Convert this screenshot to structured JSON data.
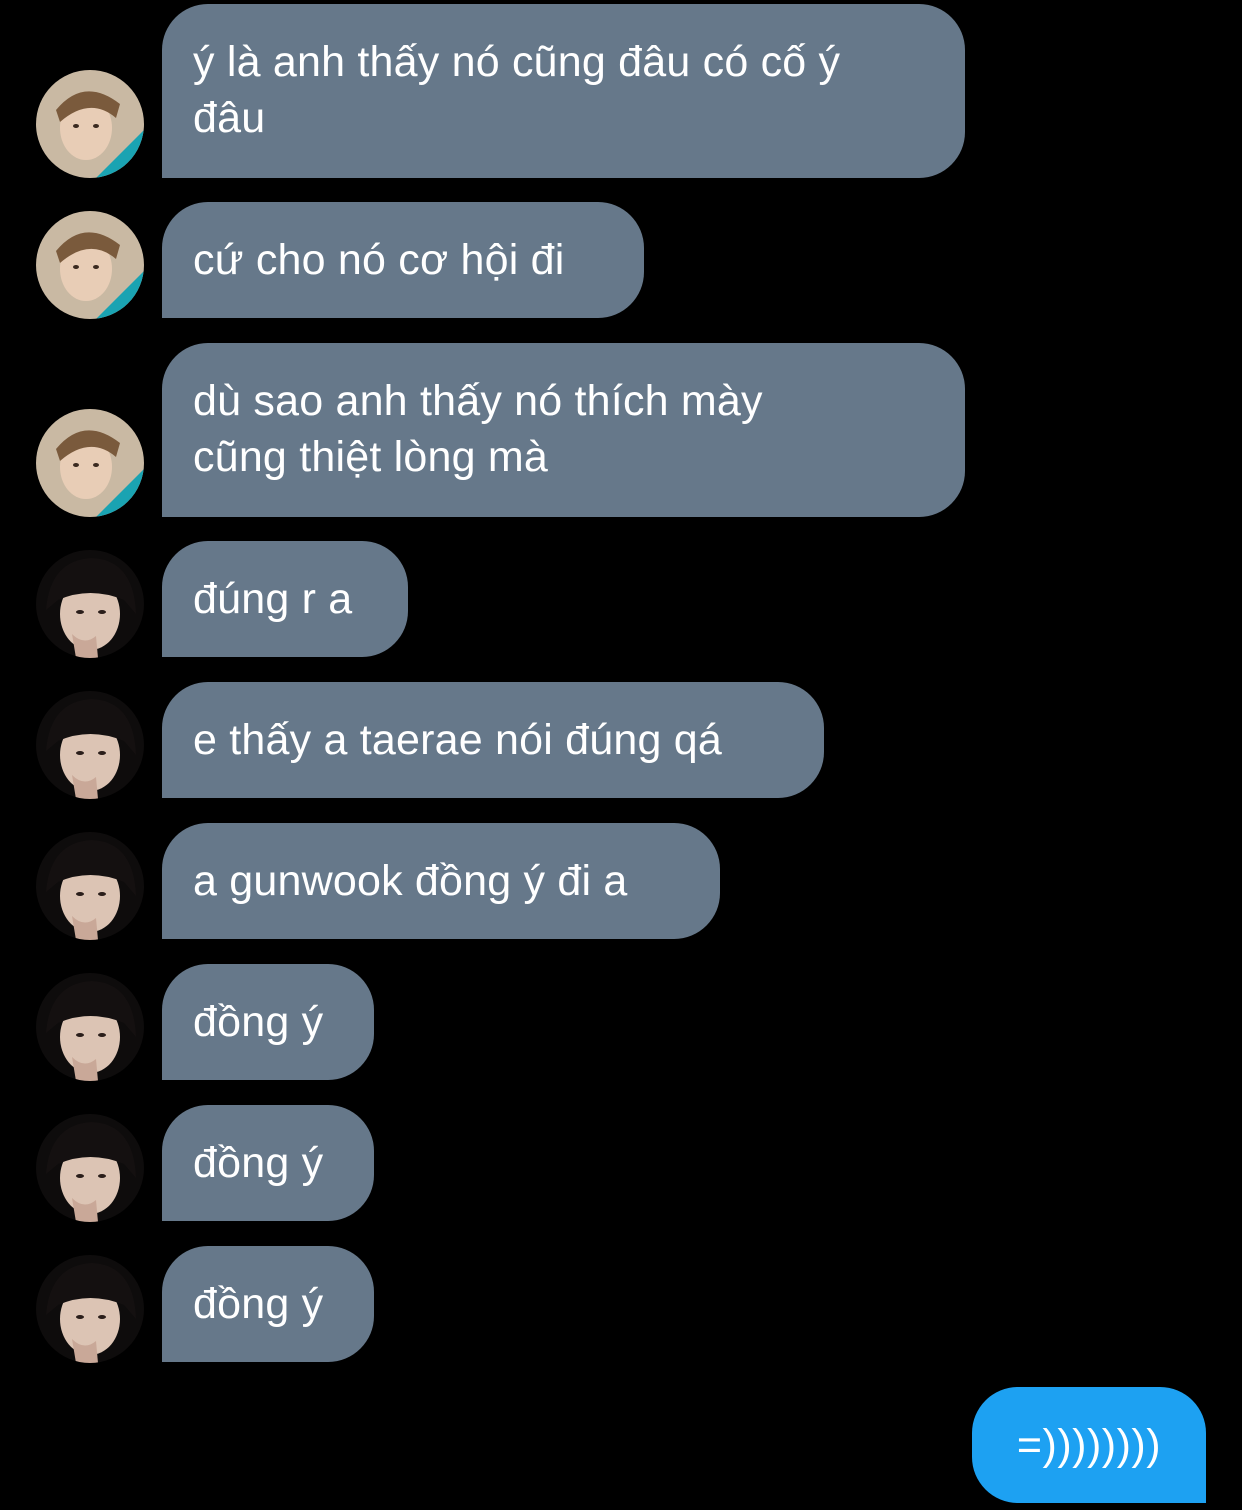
{
  "colors": {
    "background": "#000000",
    "incoming_bubble": "#66788a",
    "outgoing_bubble": "#1da1f2",
    "text": "#ffffff"
  },
  "messages": [
    {
      "sender": "avatar-boy",
      "text": "ý là anh thấy nó cũng đâu có cố ý\nđâu"
    },
    {
      "sender": "avatar-boy",
      "text": "cứ cho nó cơ hội đi"
    },
    {
      "sender": "avatar-boy",
      "text": "dù sao anh thấy nó thích mày\ncũng thiệt lòng mà"
    },
    {
      "sender": "avatar-girl",
      "text": "đúng r a"
    },
    {
      "sender": "avatar-girl",
      "text": "e thấy a taerae nói đúng qá"
    },
    {
      "sender": "avatar-girl",
      "text": "a gunwook đồng ý đi a"
    },
    {
      "sender": "avatar-girl",
      "text": "đồng ý"
    },
    {
      "sender": "avatar-girl",
      "text": "đồng ý"
    },
    {
      "sender": "avatar-girl",
      "text": "đồng ý"
    }
  ],
  "outgoing": {
    "text": "=))))))))"
  }
}
